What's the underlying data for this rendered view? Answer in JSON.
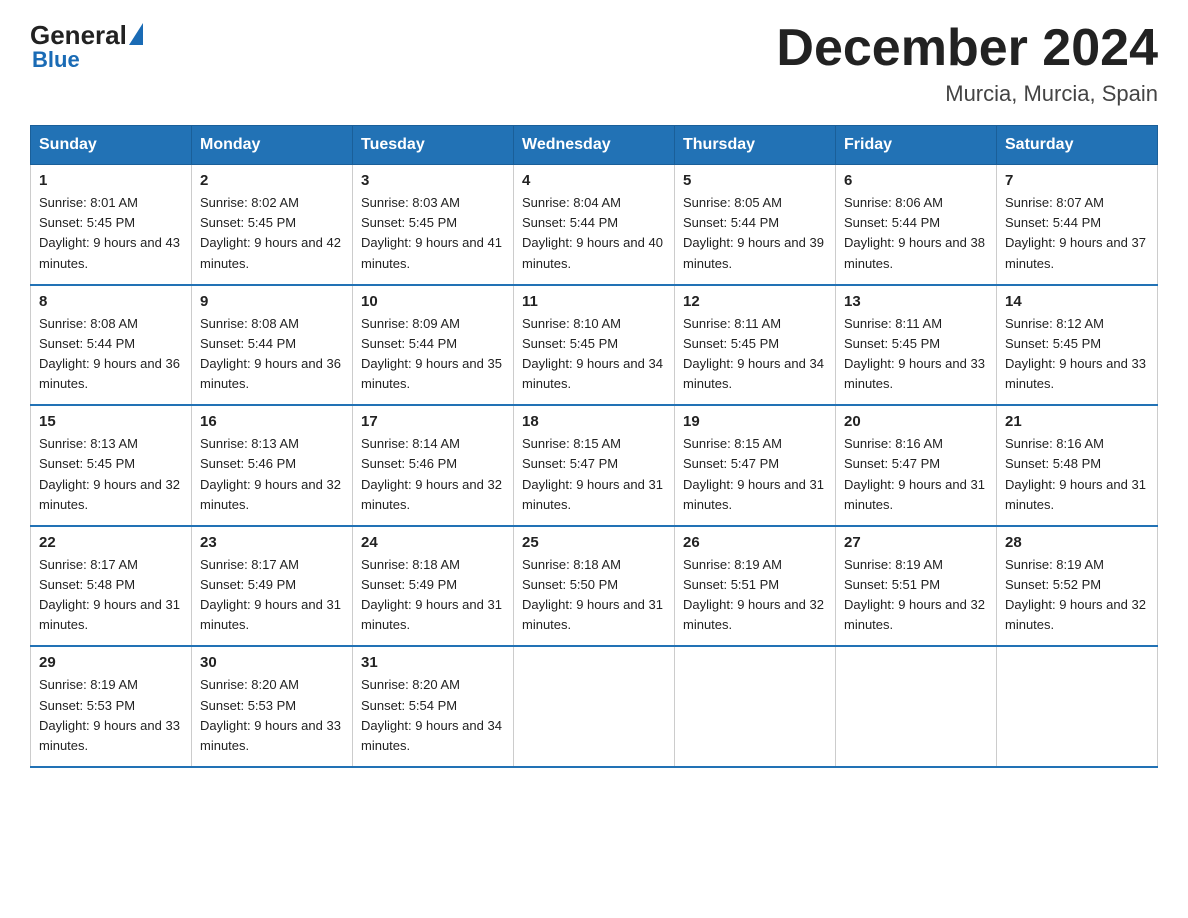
{
  "logo": {
    "general": "General",
    "blue": "Blue",
    "subtitle": "Blue"
  },
  "header": {
    "title": "December 2024",
    "location": "Murcia, Murcia, Spain"
  },
  "weekdays": [
    "Sunday",
    "Monday",
    "Tuesday",
    "Wednesday",
    "Thursday",
    "Friday",
    "Saturday"
  ],
  "weeks": [
    [
      {
        "day": "1",
        "sunrise": "8:01 AM",
        "sunset": "5:45 PM",
        "daylight": "9 hours and 43 minutes."
      },
      {
        "day": "2",
        "sunrise": "8:02 AM",
        "sunset": "5:45 PM",
        "daylight": "9 hours and 42 minutes."
      },
      {
        "day": "3",
        "sunrise": "8:03 AM",
        "sunset": "5:45 PM",
        "daylight": "9 hours and 41 minutes."
      },
      {
        "day": "4",
        "sunrise": "8:04 AM",
        "sunset": "5:44 PM",
        "daylight": "9 hours and 40 minutes."
      },
      {
        "day": "5",
        "sunrise": "8:05 AM",
        "sunset": "5:44 PM",
        "daylight": "9 hours and 39 minutes."
      },
      {
        "day": "6",
        "sunrise": "8:06 AM",
        "sunset": "5:44 PM",
        "daylight": "9 hours and 38 minutes."
      },
      {
        "day": "7",
        "sunrise": "8:07 AM",
        "sunset": "5:44 PM",
        "daylight": "9 hours and 37 minutes."
      }
    ],
    [
      {
        "day": "8",
        "sunrise": "8:08 AM",
        "sunset": "5:44 PM",
        "daylight": "9 hours and 36 minutes."
      },
      {
        "day": "9",
        "sunrise": "8:08 AM",
        "sunset": "5:44 PM",
        "daylight": "9 hours and 36 minutes."
      },
      {
        "day": "10",
        "sunrise": "8:09 AM",
        "sunset": "5:44 PM",
        "daylight": "9 hours and 35 minutes."
      },
      {
        "day": "11",
        "sunrise": "8:10 AM",
        "sunset": "5:45 PM",
        "daylight": "9 hours and 34 minutes."
      },
      {
        "day": "12",
        "sunrise": "8:11 AM",
        "sunset": "5:45 PM",
        "daylight": "9 hours and 34 minutes."
      },
      {
        "day": "13",
        "sunrise": "8:11 AM",
        "sunset": "5:45 PM",
        "daylight": "9 hours and 33 minutes."
      },
      {
        "day": "14",
        "sunrise": "8:12 AM",
        "sunset": "5:45 PM",
        "daylight": "9 hours and 33 minutes."
      }
    ],
    [
      {
        "day": "15",
        "sunrise": "8:13 AM",
        "sunset": "5:45 PM",
        "daylight": "9 hours and 32 minutes."
      },
      {
        "day": "16",
        "sunrise": "8:13 AM",
        "sunset": "5:46 PM",
        "daylight": "9 hours and 32 minutes."
      },
      {
        "day": "17",
        "sunrise": "8:14 AM",
        "sunset": "5:46 PM",
        "daylight": "9 hours and 32 minutes."
      },
      {
        "day": "18",
        "sunrise": "8:15 AM",
        "sunset": "5:47 PM",
        "daylight": "9 hours and 31 minutes."
      },
      {
        "day": "19",
        "sunrise": "8:15 AM",
        "sunset": "5:47 PM",
        "daylight": "9 hours and 31 minutes."
      },
      {
        "day": "20",
        "sunrise": "8:16 AM",
        "sunset": "5:47 PM",
        "daylight": "9 hours and 31 minutes."
      },
      {
        "day": "21",
        "sunrise": "8:16 AM",
        "sunset": "5:48 PM",
        "daylight": "9 hours and 31 minutes."
      }
    ],
    [
      {
        "day": "22",
        "sunrise": "8:17 AM",
        "sunset": "5:48 PM",
        "daylight": "9 hours and 31 minutes."
      },
      {
        "day": "23",
        "sunrise": "8:17 AM",
        "sunset": "5:49 PM",
        "daylight": "9 hours and 31 minutes."
      },
      {
        "day": "24",
        "sunrise": "8:18 AM",
        "sunset": "5:49 PM",
        "daylight": "9 hours and 31 minutes."
      },
      {
        "day": "25",
        "sunrise": "8:18 AM",
        "sunset": "5:50 PM",
        "daylight": "9 hours and 31 minutes."
      },
      {
        "day": "26",
        "sunrise": "8:19 AM",
        "sunset": "5:51 PM",
        "daylight": "9 hours and 32 minutes."
      },
      {
        "day": "27",
        "sunrise": "8:19 AM",
        "sunset": "5:51 PM",
        "daylight": "9 hours and 32 minutes."
      },
      {
        "day": "28",
        "sunrise": "8:19 AM",
        "sunset": "5:52 PM",
        "daylight": "9 hours and 32 minutes."
      }
    ],
    [
      {
        "day": "29",
        "sunrise": "8:19 AM",
        "sunset": "5:53 PM",
        "daylight": "9 hours and 33 minutes."
      },
      {
        "day": "30",
        "sunrise": "8:20 AM",
        "sunset": "5:53 PM",
        "daylight": "9 hours and 33 minutes."
      },
      {
        "day": "31",
        "sunrise": "8:20 AM",
        "sunset": "5:54 PM",
        "daylight": "9 hours and 34 minutes."
      },
      null,
      null,
      null,
      null
    ]
  ]
}
